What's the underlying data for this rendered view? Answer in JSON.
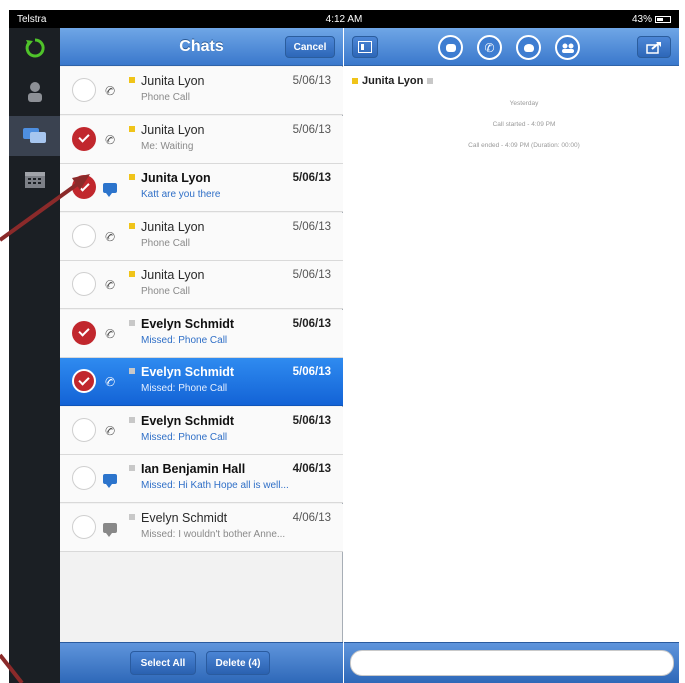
{
  "status_bar": {
    "carrier": "Telstra",
    "time": "4:12 AM",
    "battery": "43%"
  },
  "colors": {
    "accent": "#3a78cc",
    "selected": "#1a6fe0",
    "checked": "#c1272d",
    "presence_yellow": "#f0c419",
    "presence_gray": "#c8c8c8",
    "annotation_arrow": "#8b2a2a"
  },
  "rail": {
    "items": [
      {
        "icon": "refresh-icon",
        "active": false
      },
      {
        "icon": "person-icon",
        "active": false
      },
      {
        "icon": "chat-icon",
        "active": true
      },
      {
        "icon": "calendar-icon",
        "active": false
      }
    ]
  },
  "list_panel": {
    "title": "Chats",
    "cancel_label": "Cancel",
    "rows": [
      {
        "checked": false,
        "type_icon": "phone-icon",
        "presence": "yellow",
        "name": "Junita Lyon",
        "subtitle": "Phone Call",
        "date": "5/06/13",
        "bold": false,
        "blue": false,
        "selected": false
      },
      {
        "checked": true,
        "type_icon": "phone-icon",
        "presence": "yellow",
        "name": "Junita Lyon",
        "subtitle": "Me: Waiting",
        "date": "5/06/13",
        "bold": false,
        "blue": false,
        "selected": false
      },
      {
        "checked": true,
        "type_icon": "chat-bubble-icon",
        "presence": "yellow",
        "name": "Junita Lyon",
        "subtitle": "Katt are you there",
        "date": "5/06/13",
        "bold": true,
        "blue": true,
        "selected": false
      },
      {
        "checked": false,
        "type_icon": "phone-icon",
        "presence": "yellow",
        "name": "Junita Lyon",
        "subtitle": "Phone Call",
        "date": "5/06/13",
        "bold": false,
        "blue": false,
        "selected": false
      },
      {
        "checked": false,
        "type_icon": "phone-icon",
        "presence": "yellow",
        "name": "Junita Lyon",
        "subtitle": "Phone Call",
        "date": "5/06/13",
        "bold": false,
        "blue": false,
        "selected": false
      },
      {
        "checked": true,
        "type_icon": "phone-icon",
        "presence": "gray",
        "name": "Evelyn Schmidt",
        "subtitle": "Missed: Phone Call",
        "date": "5/06/13",
        "bold": true,
        "blue": true,
        "selected": false
      },
      {
        "checked": true,
        "type_icon": "phone-icon",
        "presence": "gray",
        "name": "Evelyn Schmidt",
        "subtitle": "Missed: Phone Call",
        "date": "5/06/13",
        "bold": true,
        "blue": true,
        "selected": true
      },
      {
        "checked": false,
        "type_icon": "phone-icon",
        "presence": "gray",
        "name": "Evelyn Schmidt",
        "subtitle": "Missed: Phone Call",
        "date": "5/06/13",
        "bold": true,
        "blue": true,
        "selected": false
      },
      {
        "checked": false,
        "type_icon": "chat-bubble-icon",
        "presence": "gray",
        "name": "Ian Benjamin Hall",
        "subtitle": "Missed: Hi Kath Hope all is well...",
        "date": "4/06/13",
        "bold": true,
        "blue": true,
        "selected": false
      },
      {
        "checked": false,
        "type_icon": "chat-bubble-gray-icon",
        "presence": "gray",
        "name": "Evelyn Schmidt",
        "subtitle": "Missed: I wouldn't bother Anne...",
        "date": "4/06/13",
        "bold": false,
        "blue": false,
        "selected": false
      }
    ],
    "footer": {
      "select_all_label": "Select All",
      "delete_label": "Delete (4)"
    }
  },
  "detail_panel": {
    "contact_name": "Junita Lyon",
    "header_icons": [
      "contact-card-icon",
      "chat-icon",
      "phone-icon",
      "voicemail-icon",
      "group-icon",
      "share-icon"
    ],
    "lines": [
      "Yesterday",
      "Call started - 4:09 PM",
      "Call ended - 4:09 PM (Duration: 00:00)"
    ]
  }
}
